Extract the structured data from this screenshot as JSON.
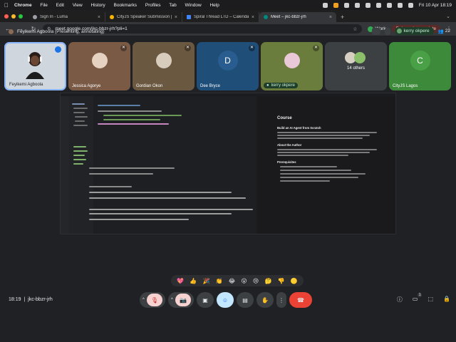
{
  "macbar": {
    "app": "Chrome",
    "menus": [
      "File",
      "Edit",
      "View",
      "History",
      "Bookmarks",
      "Profiles",
      "Tab",
      "Window",
      "Help"
    ],
    "datetime": "Fri 10 Apr  18:19"
  },
  "tabs": [
    {
      "label": "Sign In - Luma",
      "active": false
    },
    {
      "label": "CityJS Speaker Submission | ...",
      "active": false
    },
    {
      "label": "Spiral Thread LTD – Calendar",
      "active": false
    },
    {
      "label": "Meet – jkc-bbzr-jrh",
      "active": true
    }
  ],
  "toolbar": {
    "url": "meet.google.com/jkc-bbzr-jrh?pli=1",
    "profile": "Work",
    "relaunch": "Relaunch to update"
  },
  "meeting": {
    "presenting_label": "Feyikemi Agboola (Presenting, annotating)",
    "pinned_participant": "kerry okpere",
    "participant_count": "22",
    "code": "jkc-bbzr-jrh",
    "time": "18:19"
  },
  "participants": [
    {
      "name": "Feyikemi Agboola",
      "letter": "",
      "bg": "#cfd6de"
    },
    {
      "name": "Jessica Agorye",
      "letter": "",
      "bg": "#7a5a45"
    },
    {
      "name": "Gordian Okon",
      "letter": "",
      "bg": "#6b5840"
    },
    {
      "name": "Dee Bryce",
      "letter": "D",
      "bg": "#1f4e79"
    },
    {
      "name": "kerry okpere",
      "letter": "",
      "bg": "#6b7d3c"
    },
    {
      "name": "14 others",
      "letter": "",
      "bg": "#3c4043"
    },
    {
      "name": "CityJS Lagos",
      "letter": "C",
      "bg": "#3d8a3a"
    }
  ],
  "shared_screen": {
    "doc_title": "Course",
    "section_1": "Build an AI Agent from Scratch",
    "section_2": "About the Author",
    "section_3": "Prerequisites"
  },
  "reactions": [
    "💖",
    "👍",
    "🎉",
    "👏",
    "😂",
    "😮",
    "😢",
    "🤔",
    "👎",
    "🟡"
  ]
}
